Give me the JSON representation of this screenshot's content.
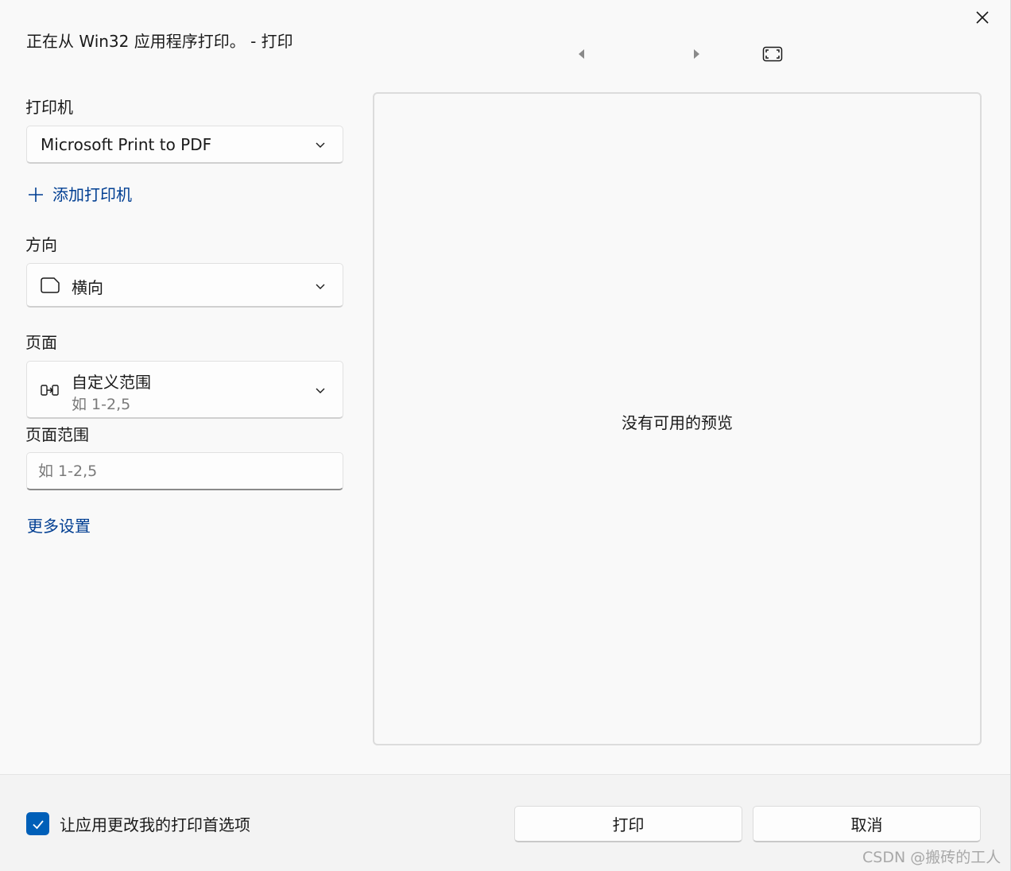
{
  "window": {
    "title": "正在从 Win32 应用程序打印。 - 打印"
  },
  "icons": {
    "close": "close-icon",
    "prev": "triangle-left-icon",
    "next": "triangle-right-icon",
    "fit": "fit-page-icon",
    "orientation": "landscape-page-icon",
    "pages": "page-range-icon",
    "chevron": "chevron-down-icon",
    "add": "plus-icon",
    "check": "checkmark-icon"
  },
  "printer": {
    "label": "打印机",
    "selected": "Microsoft Print to PDF",
    "add_label": "添加打印机"
  },
  "orientation": {
    "label": "方向",
    "selected": "横向"
  },
  "pages": {
    "label": "页面",
    "selected": "自定义范围",
    "hint": "如 1-2,5"
  },
  "page_range": {
    "label": "页面范围",
    "placeholder": "如 1-2,5",
    "value": ""
  },
  "more_settings": "更多设置",
  "preview": {
    "message": "没有可用的预览"
  },
  "footer": {
    "checkbox_label": "让应用更改我的打印首选项",
    "checkbox_checked": true,
    "print_button": "打印",
    "cancel_button": "取消"
  },
  "watermark": "CSDN @搬砖的工人",
  "colors": {
    "accent": "#005fb8",
    "link": "#003e92",
    "background": "#f9f9f9",
    "footer": "#f3f3f3"
  }
}
